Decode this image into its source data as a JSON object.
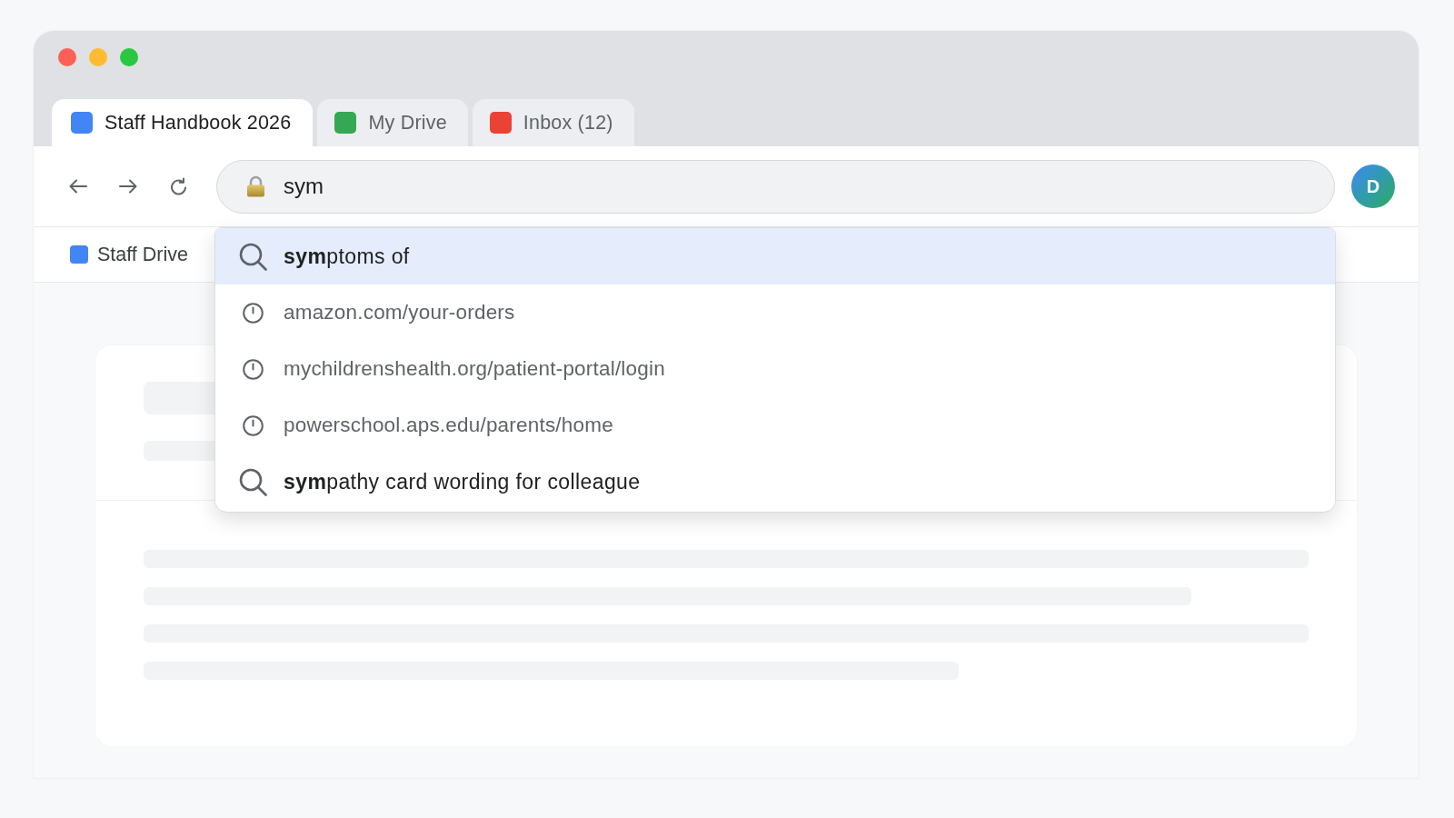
{
  "tabs": [
    {
      "title": "Staff Handbook 2026",
      "selected": true,
      "color": "#4285f4"
    },
    {
      "title": "My Drive",
      "selected": false,
      "color": "#34a853"
    },
    {
      "title": "Inbox (12)",
      "selected": false,
      "color": "#ea4335"
    }
  ],
  "address_bar": {
    "value": "sym"
  },
  "profile": {
    "initial": "D"
  },
  "bookmarks": [
    {
      "label": "Staff Drive"
    }
  ],
  "suggestions": [
    {
      "kind": "search",
      "text": "**sym**ptoms of",
      "selected": true
    },
    {
      "kind": "history",
      "text": "amazon.com/your-orders",
      "selected": false
    },
    {
      "kind": "history",
      "text": "mychildrenshealth.org/patient-portal/login",
      "selected": false
    },
    {
      "kind": "history",
      "text": "powerschool.aps.edu/parents/home",
      "selected": false
    },
    {
      "kind": "search",
      "text": "**sym**pathy card wording for colleague",
      "selected": false
    }
  ]
}
